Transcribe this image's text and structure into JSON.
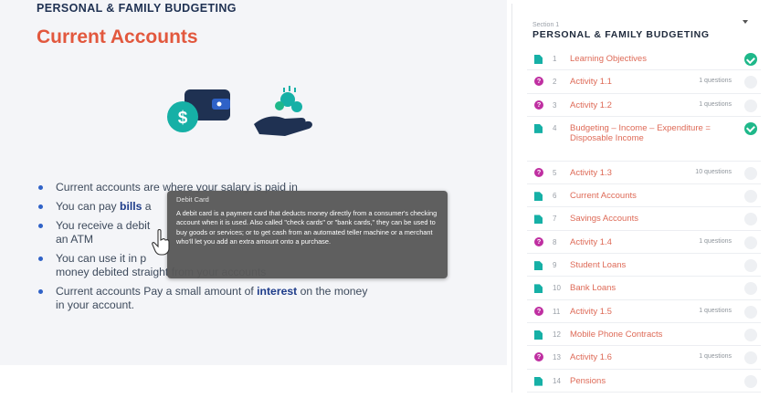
{
  "course_title": "PERSONAL & FAMILY BUDGETING",
  "page_title": "Current Accounts",
  "colors": {
    "accent": "#e2583e",
    "keyword": "#1e3c8a",
    "bullet": "#2f62c7",
    "teal": "#16b0a6",
    "quiz": "#bf2fa1",
    "done": "#1fb88a"
  },
  "hero_icons": [
    "wallet-with-dollar-coin-icon",
    "hand-holding-money-icon"
  ],
  "bullets": [
    {
      "before": "Current accounts are where your salary is paid in",
      "keyword": "",
      "after": ""
    },
    {
      "before": "You can pay ",
      "keyword": "bills",
      "after": " a"
    },
    {
      "before": "You receive a debit",
      "keyword": "",
      "after": "",
      "line2": "an ATM"
    },
    {
      "before": "You can use it in p",
      "keyword": "",
      "after": "",
      "line2": "money debited straight from your accounts"
    },
    {
      "before": "Current accounts Pay a small amount of ",
      "keyword": "interest",
      "after": " on the money",
      "line2": "in your account."
    }
  ],
  "tooltip": {
    "title": "Debit Card",
    "body": "A debit card is a payment card that deducts money directly from a consumer's checking account when it is used. Also called \"check cards\" or \"bank cards,\" they can be used to buy goods or services; or to get cash from an automated teller machine or a merchant who'll let you add an extra amount onto a purchase."
  },
  "sidebar": {
    "section_label": "Section 1",
    "section_title": "PERSONAL & FAMILY BUDGETING",
    "lessons": [
      {
        "type": "doc",
        "num": "1",
        "name": "Learning Objectives",
        "questions": "",
        "done": true
      },
      {
        "type": "quiz",
        "num": "2",
        "name": "Activity 1.1",
        "questions": "1 questions",
        "done": false
      },
      {
        "type": "quiz",
        "num": "3",
        "name": "Activity 1.2",
        "questions": "1 questions",
        "done": false
      },
      {
        "type": "doc",
        "num": "4",
        "name": "Budgeting – Income – Expenditure = Disposable Income",
        "questions": "",
        "done": true
      },
      {
        "type": "quiz",
        "num": "5",
        "name": "Activity 1.3",
        "questions": "10 questions",
        "done": false
      },
      {
        "type": "doc",
        "num": "6",
        "name": "Current Accounts",
        "questions": "",
        "done": false
      },
      {
        "type": "doc",
        "num": "7",
        "name": "Savings Accounts",
        "questions": "",
        "done": false
      },
      {
        "type": "quiz",
        "num": "8",
        "name": "Activity 1.4",
        "questions": "1 questions",
        "done": false
      },
      {
        "type": "doc",
        "num": "9",
        "name": "Student Loans",
        "questions": "",
        "done": false
      },
      {
        "type": "doc",
        "num": "10",
        "name": "Bank Loans",
        "questions": "",
        "done": false
      },
      {
        "type": "quiz",
        "num": "11",
        "name": "Activity 1.5",
        "questions": "1 questions",
        "done": false
      },
      {
        "type": "doc",
        "num": "12",
        "name": "Mobile Phone Contracts",
        "questions": "",
        "done": false
      },
      {
        "type": "quiz",
        "num": "13",
        "name": "Activity 1.6",
        "questions": "1 questions",
        "done": false
      },
      {
        "type": "doc",
        "num": "14",
        "name": "Pensions",
        "questions": "",
        "done": false
      }
    ]
  }
}
